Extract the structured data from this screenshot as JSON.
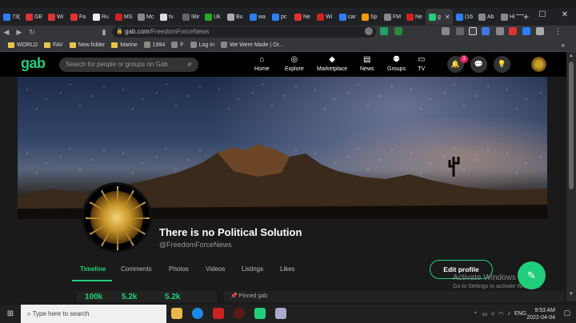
{
  "browser": {
    "tabs": [
      {
        "label": "73(",
        "color": "#2d7ff9"
      },
      {
        "label": "GE",
        "color": "#d33"
      },
      {
        "label": "Wi",
        "color": "#d33"
      },
      {
        "label": "Fa",
        "color": "#d33"
      },
      {
        "label": "Ru",
        "color": "#eee"
      },
      {
        "label": "MS",
        "color": "#c22"
      },
      {
        "label": "Mc",
        "color": "#888"
      },
      {
        "label": "tv.",
        "color": "#ddd"
      },
      {
        "label": "IBir",
        "color": "#666"
      },
      {
        "label": "Uk",
        "color": "#2a2"
      },
      {
        "label": "Bu",
        "color": "#aaa"
      },
      {
        "label": "wa",
        "color": "#2d7ff9"
      },
      {
        "label": "pc",
        "color": "#2d7ff9"
      },
      {
        "label": "Ne",
        "color": "#d33"
      },
      {
        "label": "Wi",
        "color": "#c22"
      },
      {
        "label": "car",
        "color": "#2d7ff9"
      },
      {
        "label": "Sp",
        "color": "#f90"
      },
      {
        "label": "FM",
        "color": "#888"
      },
      {
        "label": "Ne",
        "color": "#c22"
      }
    ],
    "active_tab_label": "g",
    "tabs_after": [
      {
        "label": "(16",
        "color": "#2d7ff9"
      },
      {
        "label": "Ab",
        "color": "#888"
      },
      {
        "label": "Hi",
        "color": "#888"
      }
    ],
    "new_tab": "+",
    "window_controls": {
      "minimize": "—",
      "maximize": "☐",
      "close": "✕"
    },
    "url_host": "gab.com",
    "url_path": "/FreedomForceNews",
    "bookmarks": [
      {
        "label": "WORLD",
        "type": "folder"
      },
      {
        "label": "FAV",
        "type": "folder"
      },
      {
        "label": "New folder",
        "type": "folder"
      },
      {
        "label": "Marine",
        "type": "folder"
      },
      {
        "label": "1984",
        "type": "site"
      },
      {
        "label": "F",
        "type": "site"
      },
      {
        "label": "Log In",
        "type": "site"
      },
      {
        "label": "We Were Made | Or...",
        "type": "site"
      }
    ],
    "bookmarks_more": "»"
  },
  "gab": {
    "logo": "gab",
    "search_placeholder": "Search for people or groups on Gab",
    "nav": [
      {
        "label": "Home",
        "icon": "⌂"
      },
      {
        "label": "Explore",
        "icon": "◎"
      },
      {
        "label": "Marketplace",
        "icon": "◆"
      },
      {
        "label": "News",
        "icon": "▤"
      },
      {
        "label": "Groups",
        "icon": "⚉"
      },
      {
        "label": "TV",
        "icon": "▭"
      }
    ],
    "notification_count": "3"
  },
  "profile": {
    "name": "There is no Political Solution",
    "handle": "@FreedomForceNews",
    "tabs": [
      "Timeline",
      "Comments",
      "Photos",
      "Videos",
      "Listings",
      "Likes"
    ],
    "active_tab": "Timeline",
    "edit_button": "Edit profile",
    "stats": [
      "100k",
      "5.2k",
      "5.2k"
    ],
    "pinned_label": "Pinned gab"
  },
  "watermark": {
    "line1": "Activate Windows",
    "line2": "Go to Settings to activate Windows."
  },
  "taskbar": {
    "search_placeholder": "Type here to search",
    "time": "9:53 AM",
    "date": "2022-04-04",
    "language": "ENG"
  },
  "colors": {
    "accent": "#21cf7a",
    "badge": "#e0245e"
  }
}
